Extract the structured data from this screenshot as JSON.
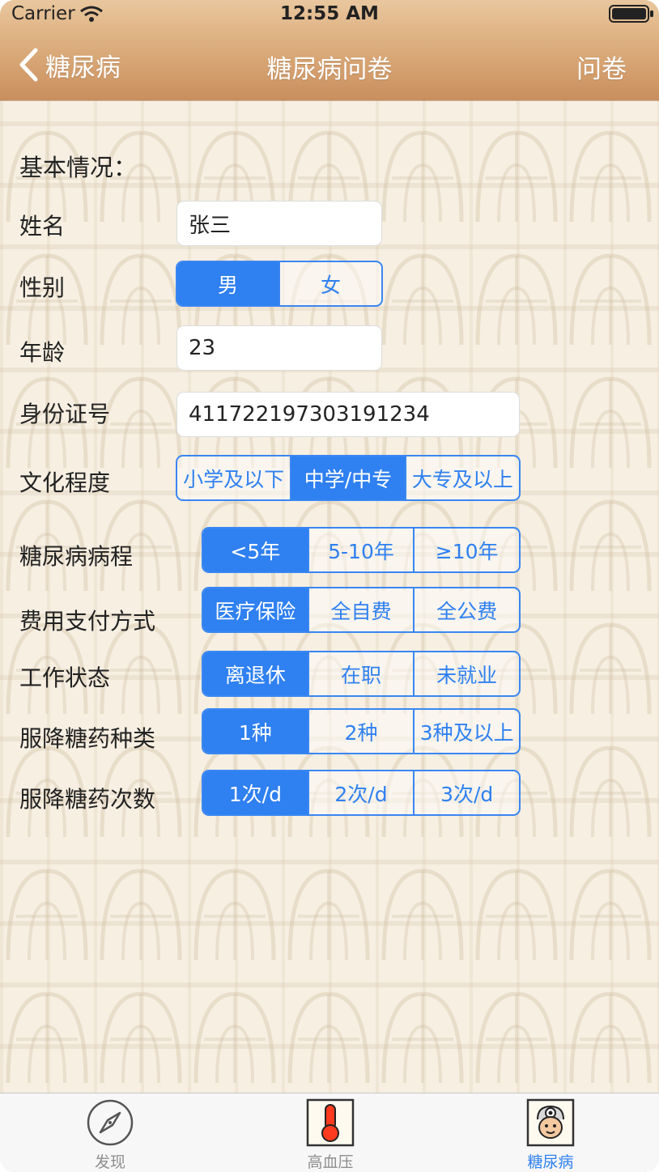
{
  "status_bar": {
    "carrier": "Carrier",
    "time": "12:55 AM"
  },
  "nav": {
    "back_label": "糖尿病",
    "title": "糖尿病问卷",
    "right_label": "问卷"
  },
  "form": {
    "section_title": "基本情况：",
    "name": {
      "label": "姓名",
      "value": "张三"
    },
    "gender": {
      "label": "性别",
      "options": [
        "男",
        "女"
      ],
      "selected": 0
    },
    "age": {
      "label": "年龄",
      "value": "23"
    },
    "id_number": {
      "label": "身份证号",
      "value": "411722197303191234"
    },
    "education": {
      "label": "文化程度",
      "options": [
        "小学及以下",
        "中学/中专",
        "大专及以上"
      ],
      "selected": 1
    },
    "duration": {
      "label": "糖尿病病程",
      "options": [
        "<5年",
        "5-10年",
        "≥10年"
      ],
      "selected": 0
    },
    "payment": {
      "label": "费用支付方式",
      "options": [
        "医疗保险",
        "全自费",
        "全公费"
      ],
      "selected": 0
    },
    "work": {
      "label": "工作状态",
      "options": [
        "离退休",
        "在职",
        "未就业"
      ],
      "selected": 0
    },
    "drug_types": {
      "label": "服降糖药种类",
      "options": [
        "1种",
        "2种",
        "3种及以上"
      ],
      "selected": 0
    },
    "drug_times": {
      "label": "服降糖药次数",
      "options": [
        "1次/d",
        "2次/d",
        "3次/d"
      ],
      "selected": 0
    }
  },
  "tabbar": {
    "tabs": [
      {
        "label": "发现",
        "icon": "compass-icon",
        "active": false
      },
      {
        "label": "高血压",
        "icon": "thermometer-icon",
        "active": false
      },
      {
        "label": "糖尿病",
        "icon": "doctor-icon",
        "active": true
      }
    ],
    "active_color": "#2f80f0"
  },
  "colors": {
    "accent": "#2f80f0",
    "header": "#d9a877",
    "background": "#f6efe2"
  }
}
